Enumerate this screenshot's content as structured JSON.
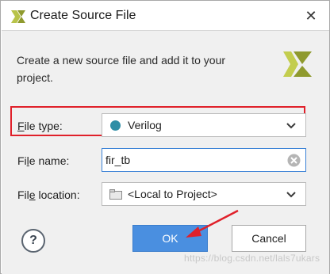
{
  "window": {
    "title": "Create Source File",
    "close_glyph": "✕"
  },
  "description": "Create a new source file and add it to your project.",
  "fields": {
    "file_type": {
      "label_first": "F",
      "label_rest": "ile type:",
      "value": "Verilog",
      "dot_color": "#2f8ea6"
    },
    "file_name": {
      "label_pre": "Fi",
      "label_u": "l",
      "label_post": "e name:",
      "value": "fir_tb"
    },
    "file_location": {
      "label_pre": "Fil",
      "label_u": "e",
      "label_post": " location:",
      "value": "<Local to Project>"
    }
  },
  "buttons": {
    "help": "?",
    "ok": "OK",
    "cancel": "Cancel"
  },
  "annotation": {
    "highlight_color": "#e0202a"
  },
  "watermark": "https://blog.csdn.net/lals7ukars"
}
